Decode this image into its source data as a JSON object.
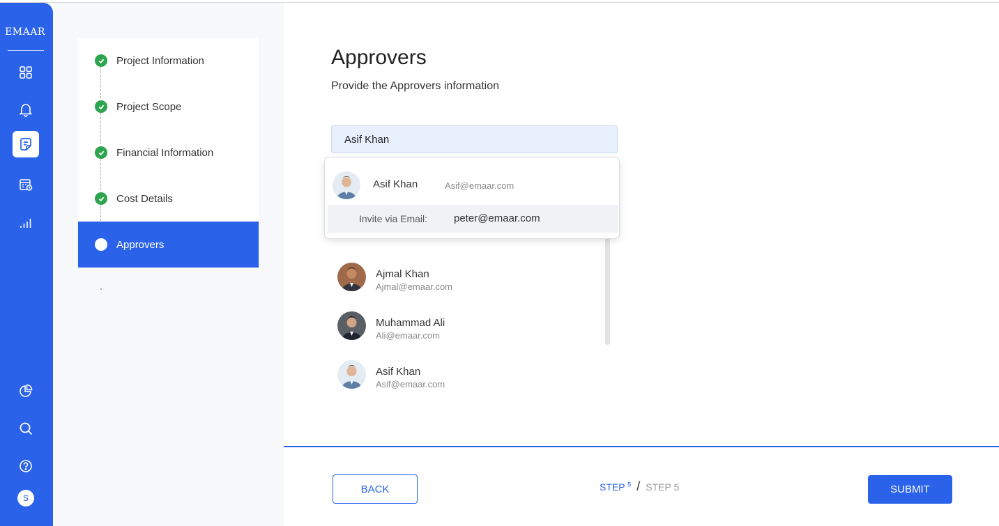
{
  "brand": {
    "logo_text": "EMAAR",
    "accent": "#2a62ea",
    "success": "#2da44e"
  },
  "sidebar": {
    "icons": [
      "grid-icon",
      "bell-icon",
      "note-icon",
      "calendar-check-icon",
      "bar-chart-icon",
      "pie-chart-icon",
      "search-icon",
      "help-icon"
    ],
    "user_initial": "S"
  },
  "stepper": {
    "steps": [
      {
        "label": "Project Information",
        "status": "done"
      },
      {
        "label": "Project Scope",
        "status": "done"
      },
      {
        "label": "Financial Information",
        "status": "done"
      },
      {
        "label": "Cost Details",
        "status": "done"
      },
      {
        "label": "Approvers",
        "status": "current"
      }
    ]
  },
  "main": {
    "title": "Approvers",
    "subtitle": "Provide the Approvers information",
    "search_value": "Asif Khan"
  },
  "dropdown": {
    "match": {
      "name": "Asif Khan",
      "email": "Asif@emaar.com"
    },
    "invite_label": "Invite via Email:",
    "invite_email": "peter@emaar.com"
  },
  "approvers": [
    {
      "name": "Ajmal Khan",
      "email": "Ajmal@emaar.com"
    },
    {
      "name": "Muhammad Ali",
      "email": "Ali@emaar.com"
    },
    {
      "name": "Asif Khan",
      "email": "Asif@emaar.com"
    }
  ],
  "footer": {
    "back_label": "BACK",
    "submit_label": "SUBMIT",
    "step_word": "STEP",
    "current_step": "5",
    "total_step": "5",
    "separator": "/"
  }
}
